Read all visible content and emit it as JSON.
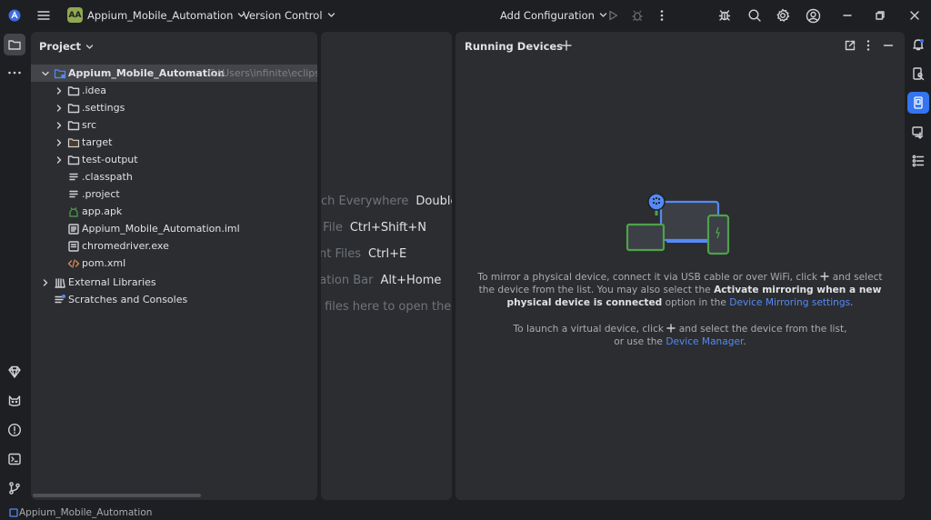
{
  "titlebar": {
    "project_badge": "AA",
    "project_name": "Appium_Mobile_Automation",
    "vcs": "Version Control",
    "run_config": "Add Configuration"
  },
  "project_panel": {
    "title": "Project",
    "root": {
      "name": "Appium_Mobile_Automation",
      "path": "C:\\Users\\infinite\\eclipse-"
    },
    "items": [
      {
        "label": ".idea"
      },
      {
        "label": ".settings"
      },
      {
        "label": "src"
      },
      {
        "label": "target"
      },
      {
        "label": "test-output"
      },
      {
        "label": ".classpath"
      },
      {
        "label": ".project"
      },
      {
        "label": "app.apk"
      },
      {
        "label": "Appium_Mobile_Automation.iml"
      },
      {
        "label": "chromedriver.exe"
      },
      {
        "label": "pom.xml"
      },
      {
        "label": "External Libraries"
      },
      {
        "label": "Scratches and Consoles"
      }
    ]
  },
  "editor_hints": [
    {
      "label": "ch Everywhere",
      "keys": "Double"
    },
    {
      "label": "o File",
      "keys": "Ctrl+Shift+N"
    },
    {
      "label": "ent Files",
      "keys": "Ctrl+E"
    },
    {
      "label": "gation Bar",
      "keys": "Alt+Home"
    },
    {
      "label": "o files here to open then",
      "keys": ""
    }
  ],
  "running_devices": {
    "title": "Running Devices",
    "mirror_1": "To mirror a physical device, connect it via USB cable or over WiFi, click",
    "mirror_2": "and select",
    "mirror_3": "the device from the list. You may also select the",
    "mirror_bold": "Activate mirroring when a new physical device is connected",
    "mirror_4": "option in the",
    "mirror_link": "Device Mirroring settings",
    "mirror_end": ".",
    "virtual_1": "To launch a virtual device, click",
    "virtual_2": "and select the device from the list, or use",
    "virtual_3": "the",
    "virtual_link": "Device Manager",
    "virtual_end": "."
  },
  "statusbar": {
    "breadcrumb": "Appium_Mobile_Automation"
  },
  "colors": {
    "background": "#1e1f22",
    "panel": "#2b2d30",
    "accent": "#3574f0",
    "link": "#548af7",
    "green": "#4ea24a"
  }
}
